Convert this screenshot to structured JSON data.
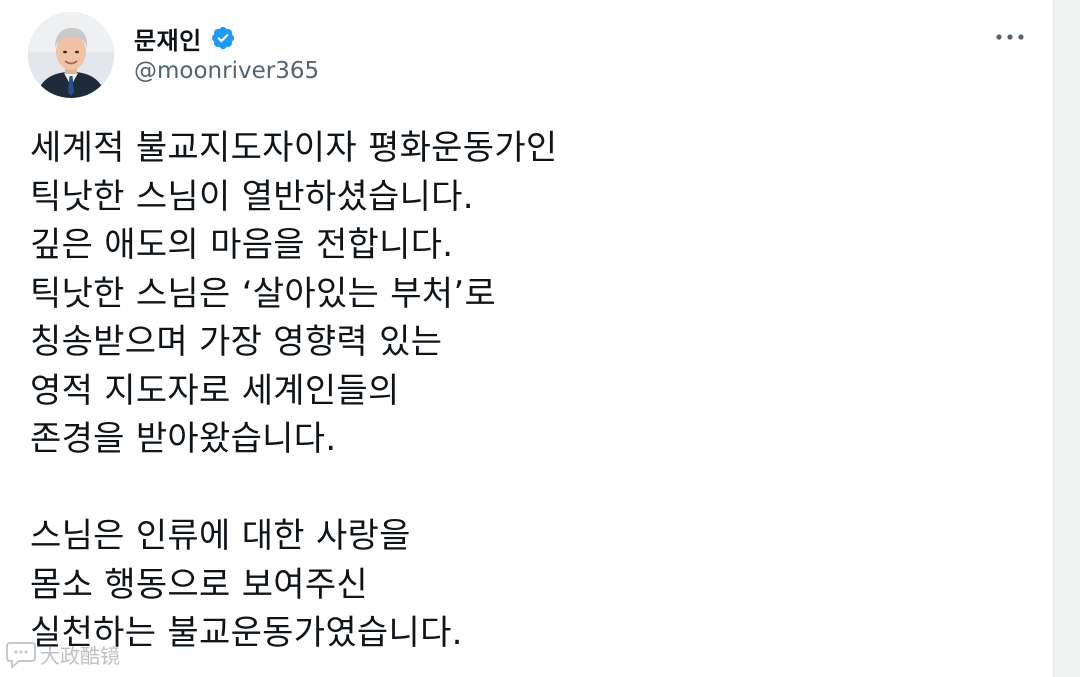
{
  "user": {
    "display_name": "문재인",
    "handle": "@moonriver365",
    "verified": true,
    "verified_color": "#1d9bf0"
  },
  "more_icon": "more-horizontal-icon",
  "tweet": {
    "lines": [
      "세계적 불교지도자이자 평화운동가인",
      "틱낫한 스님이 열반하셨습니다.",
      "깊은 애도의 마음을 전합니다.",
      "틱낫한 스님은 ‘살아있는 부처’로",
      "칭송받으며 가장 영향력 있는",
      "영적 지도자로 세계인들의",
      "존경을 받아왔습니다.",
      "",
      "스님은 인류에 대한 사랑을",
      "몸소 행동으로 보여주신",
      "실천하는 불교운동가였습니다."
    ]
  },
  "watermark": {
    "text": "大政酷镜",
    "icon": "speech-bubble-logo-icon"
  }
}
